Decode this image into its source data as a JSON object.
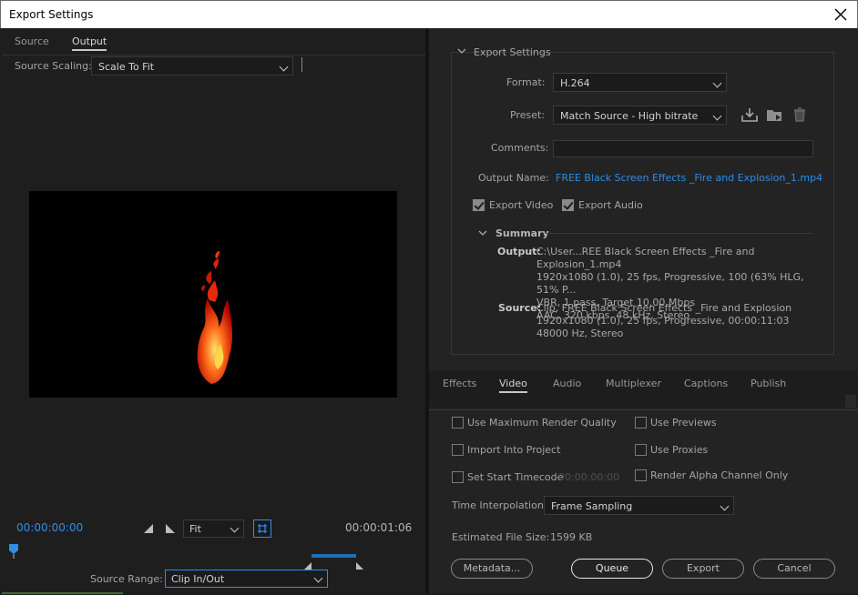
{
  "window": {
    "title": "Export Settings"
  },
  "left": {
    "tabs": [
      "Source",
      "Output"
    ],
    "active_tab": "Output",
    "source_scaling_label": "Source Scaling:",
    "source_scaling_value": "Scale To Fit",
    "timecode_start": "00:00:00:00",
    "timecode_end": "00:00:01:06",
    "zoom_value": "Fit",
    "source_range_label": "Source Range:",
    "source_range_value": "Clip In/Out"
  },
  "export": {
    "section_title": "Export Settings",
    "format_label": "Format:",
    "format_value": "H.264",
    "preset_label": "Preset:",
    "preset_value": "Match Source - High bitrate",
    "comments_label": "Comments:",
    "comments_value": "",
    "output_name_label": "Output Name:",
    "output_name_value": "FREE Black Screen Effects _Fire and Explosion_1.mp4",
    "export_video_label": "Export Video",
    "export_video_checked": true,
    "export_audio_label": "Export Audio",
    "export_audio_checked": true
  },
  "summary": {
    "title": "Summary",
    "output_label": "Output:",
    "output_lines": [
      "C:\\User...REE Black Screen Effects _Fire and Explosion_1.mp4",
      "1920x1080 (1.0), 25 fps, Progressive, 100 (63% HLG, 51% P...",
      "VBR, 1 pass, Target 10.00 Mbps",
      "AAC, 320 kbps, 48 kHz, Stereo"
    ],
    "source_label": "Source:",
    "source_lines": [
      "Clip, FREE Black Screen Effects _Fire and Explosion",
      "1920x1080 (1.0), 25 fps, Progressive, 00:00:11:03",
      "48000 Hz, Stereo"
    ]
  },
  "tabs": {
    "items": [
      "Effects",
      "Video",
      "Audio",
      "Multiplexer",
      "Captions",
      "Publish"
    ],
    "active": "Video"
  },
  "options": {
    "max_render_quality": "Use Maximum Render Quality",
    "use_previews": "Use Previews",
    "import_into_project": "Import Into Project",
    "use_proxies": "Use Proxies",
    "set_start_timecode": "Set Start Timecode",
    "start_timecode_value": "00:00:00:00",
    "render_alpha": "Render Alpha Channel Only",
    "time_interpolation_label": "Time Interpolation:",
    "time_interpolation_value": "Frame Sampling",
    "estimated_size_label": "Estimated File Size:",
    "estimated_size_value": "1599 KB"
  },
  "buttons": {
    "metadata": "Metadata...",
    "queue": "Queue",
    "export": "Export",
    "cancel": "Cancel"
  },
  "colors": {
    "accent_blue": "#2f8fe8",
    "range_bar": "#1e6fb8",
    "panel_bg": "#232323"
  }
}
